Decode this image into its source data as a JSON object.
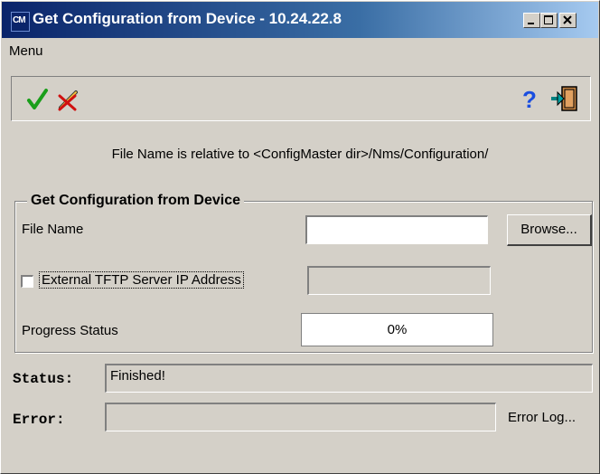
{
  "window": {
    "title": "Get Configuration from Device - 10.24.22.8",
    "app_icon_text": "CM"
  },
  "menu": {
    "items": [
      "Menu"
    ]
  },
  "toolbar": {
    "icons": [
      "checkmark-icon",
      "edit-cancel-icon",
      "help-icon",
      "exit-door-icon"
    ],
    "help_glyph": "?"
  },
  "info_text": "File Name is relative to <ConfigMaster dir>/Nms/Configuration/",
  "group": {
    "title": "Get Configuration from Device",
    "file_name_label": "File Name",
    "file_name_value": "",
    "browse_label": "Browse...",
    "tftp_label": "External TFTP Server IP Address",
    "tftp_checked": false,
    "tftp_value": "",
    "progress_label": "Progress Status",
    "progress_text": "0%",
    "progress_value": 0
  },
  "status": {
    "label": "Status:",
    "value": "Finished!"
  },
  "error": {
    "label": "Error:",
    "value": "",
    "error_log_label": "Error Log..."
  },
  "colors": {
    "titlebar_start": "#0a246a",
    "titlebar_end": "#a6caf0",
    "face": "#d4d0c8",
    "check_green": "#1a9e1a"
  }
}
